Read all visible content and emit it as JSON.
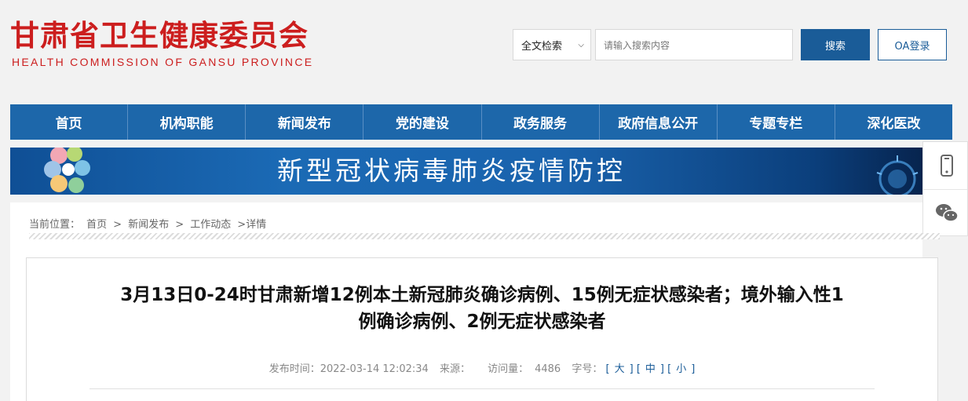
{
  "header": {
    "logo_cn": "甘肃省卫生健康委员会",
    "logo_en": "HEALTH COMMISSION OF GANSU PROVINCE"
  },
  "search": {
    "scope_selected": "全文检索",
    "placeholder": "请输入搜索内容",
    "button_label": "搜索",
    "oa_label": "OA登录"
  },
  "nav": {
    "items": [
      "首页",
      "机构职能",
      "新闻发布",
      "党的建设",
      "政务服务",
      "政府信息公开",
      "专题专栏",
      "深化医改"
    ]
  },
  "banner": {
    "title": "新型冠状病毒肺炎疫情防控"
  },
  "breadcrumb": {
    "label": "当前位置：",
    "items": [
      "首页",
      "新闻发布",
      "工作动态",
      "详情"
    ]
  },
  "article": {
    "title_line1": "3月13日0-24时甘肃新增12例本土新冠肺炎确诊病例、15例无症状感染者；境外输入性1",
    "title_line2": "例确诊病例、2例无症状感染者",
    "publish_label": "发布时间：",
    "publish_time": "2022-03-14 12:02:34",
    "source_label": "来源：",
    "source_value": "",
    "views_label": "访问量：",
    "views_value": "4486",
    "font_size_label": "字号：",
    "font_large": "大",
    "font_medium": "中",
    "font_small": "小"
  },
  "colors": {
    "brand_red": "#cc1e1e",
    "nav_blue": "#1d67aa",
    "button_blue": "#1a5c98"
  },
  "icons": {
    "side_top": "phone-icon",
    "side_bottom": "wechat-icon"
  }
}
